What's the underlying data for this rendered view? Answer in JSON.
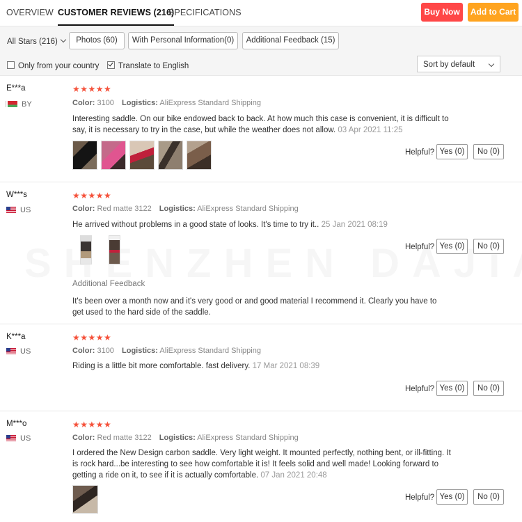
{
  "tabs": [
    "OVERVIEW",
    "CUSTOMER REVIEWS (216)",
    "SPECIFICATIONS"
  ],
  "actions": {
    "buy_now": "Buy Now",
    "add_to_cart": "Add to Cart"
  },
  "filters": {
    "stars_select": "All Stars (216)",
    "pills": [
      "Photos (60)",
      "With Personal Information(0)",
      "Additional Feedback (15)"
    ],
    "only_country": "Only from your country",
    "only_country_checked": false,
    "translate": "Translate to English",
    "translate_checked": true,
    "sort": "Sort by default"
  },
  "labels": {
    "color": "Color:",
    "logistics": "Logistics:",
    "helpful": "Helpful?",
    "additional_feedback": "Additional Feedback"
  },
  "watermark": "SHENZHEN DAJIANG",
  "reviews": [
    {
      "user": "E***a",
      "country": "BY",
      "flag": "flag-by",
      "stars": "★★★★★",
      "color": "3100",
      "logistics": "AliExpress Standard Shipping",
      "text": "Interesting saddle. On our bike endowed back to back. At how much this case is convenient, it is difficult to say, it is necessary to try in the case, but while the weather does not allow.",
      "date": "03 Apr 2021 11:25",
      "yes": "Yes (0)",
      "no": "No (0)"
    },
    {
      "user": "W***s",
      "country": "US",
      "flag": "flag-us",
      "stars": "★★★★★",
      "color": "Red matte 3122",
      "logistics": "AliExpress Standard Shipping",
      "text": "He arrived without problems in a good state of looks. It's time to try it..",
      "date": "25 Jan 2021 08:19",
      "additional": "It's been over a month now and it's very good or and good material I recommend it. Clearly you have to get used to the hard side of the saddle.",
      "yes": "Yes (0)",
      "no": "No (0)"
    },
    {
      "user": "K***a",
      "country": "US",
      "flag": "flag-us",
      "stars": "★★★★★",
      "color": "3100",
      "logistics": "AliExpress Standard Shipping",
      "text": "Riding is a little bit more comfortable. fast delivery.",
      "date": "17 Mar 2021 08:39",
      "yes": "Yes (0)",
      "no": "No (0)"
    },
    {
      "user": "M***o",
      "country": "US",
      "flag": "flag-us",
      "stars": "★★★★★",
      "color": "Red matte 3122",
      "logistics": "AliExpress Standard Shipping",
      "text": "I ordered the New Design carbon saddle. Very light weight. It mounted perfectly, nothing bent, or ill-fitting. It is rock hard...be interesting to see how comfortable it is! It feels solid and well made! Looking forward to getting a ride on it, to see if it is actually comfortable.",
      "date": "07 Jan 2021 20:48",
      "yes": "Yes (0)",
      "no": "No (0)"
    }
  ]
}
